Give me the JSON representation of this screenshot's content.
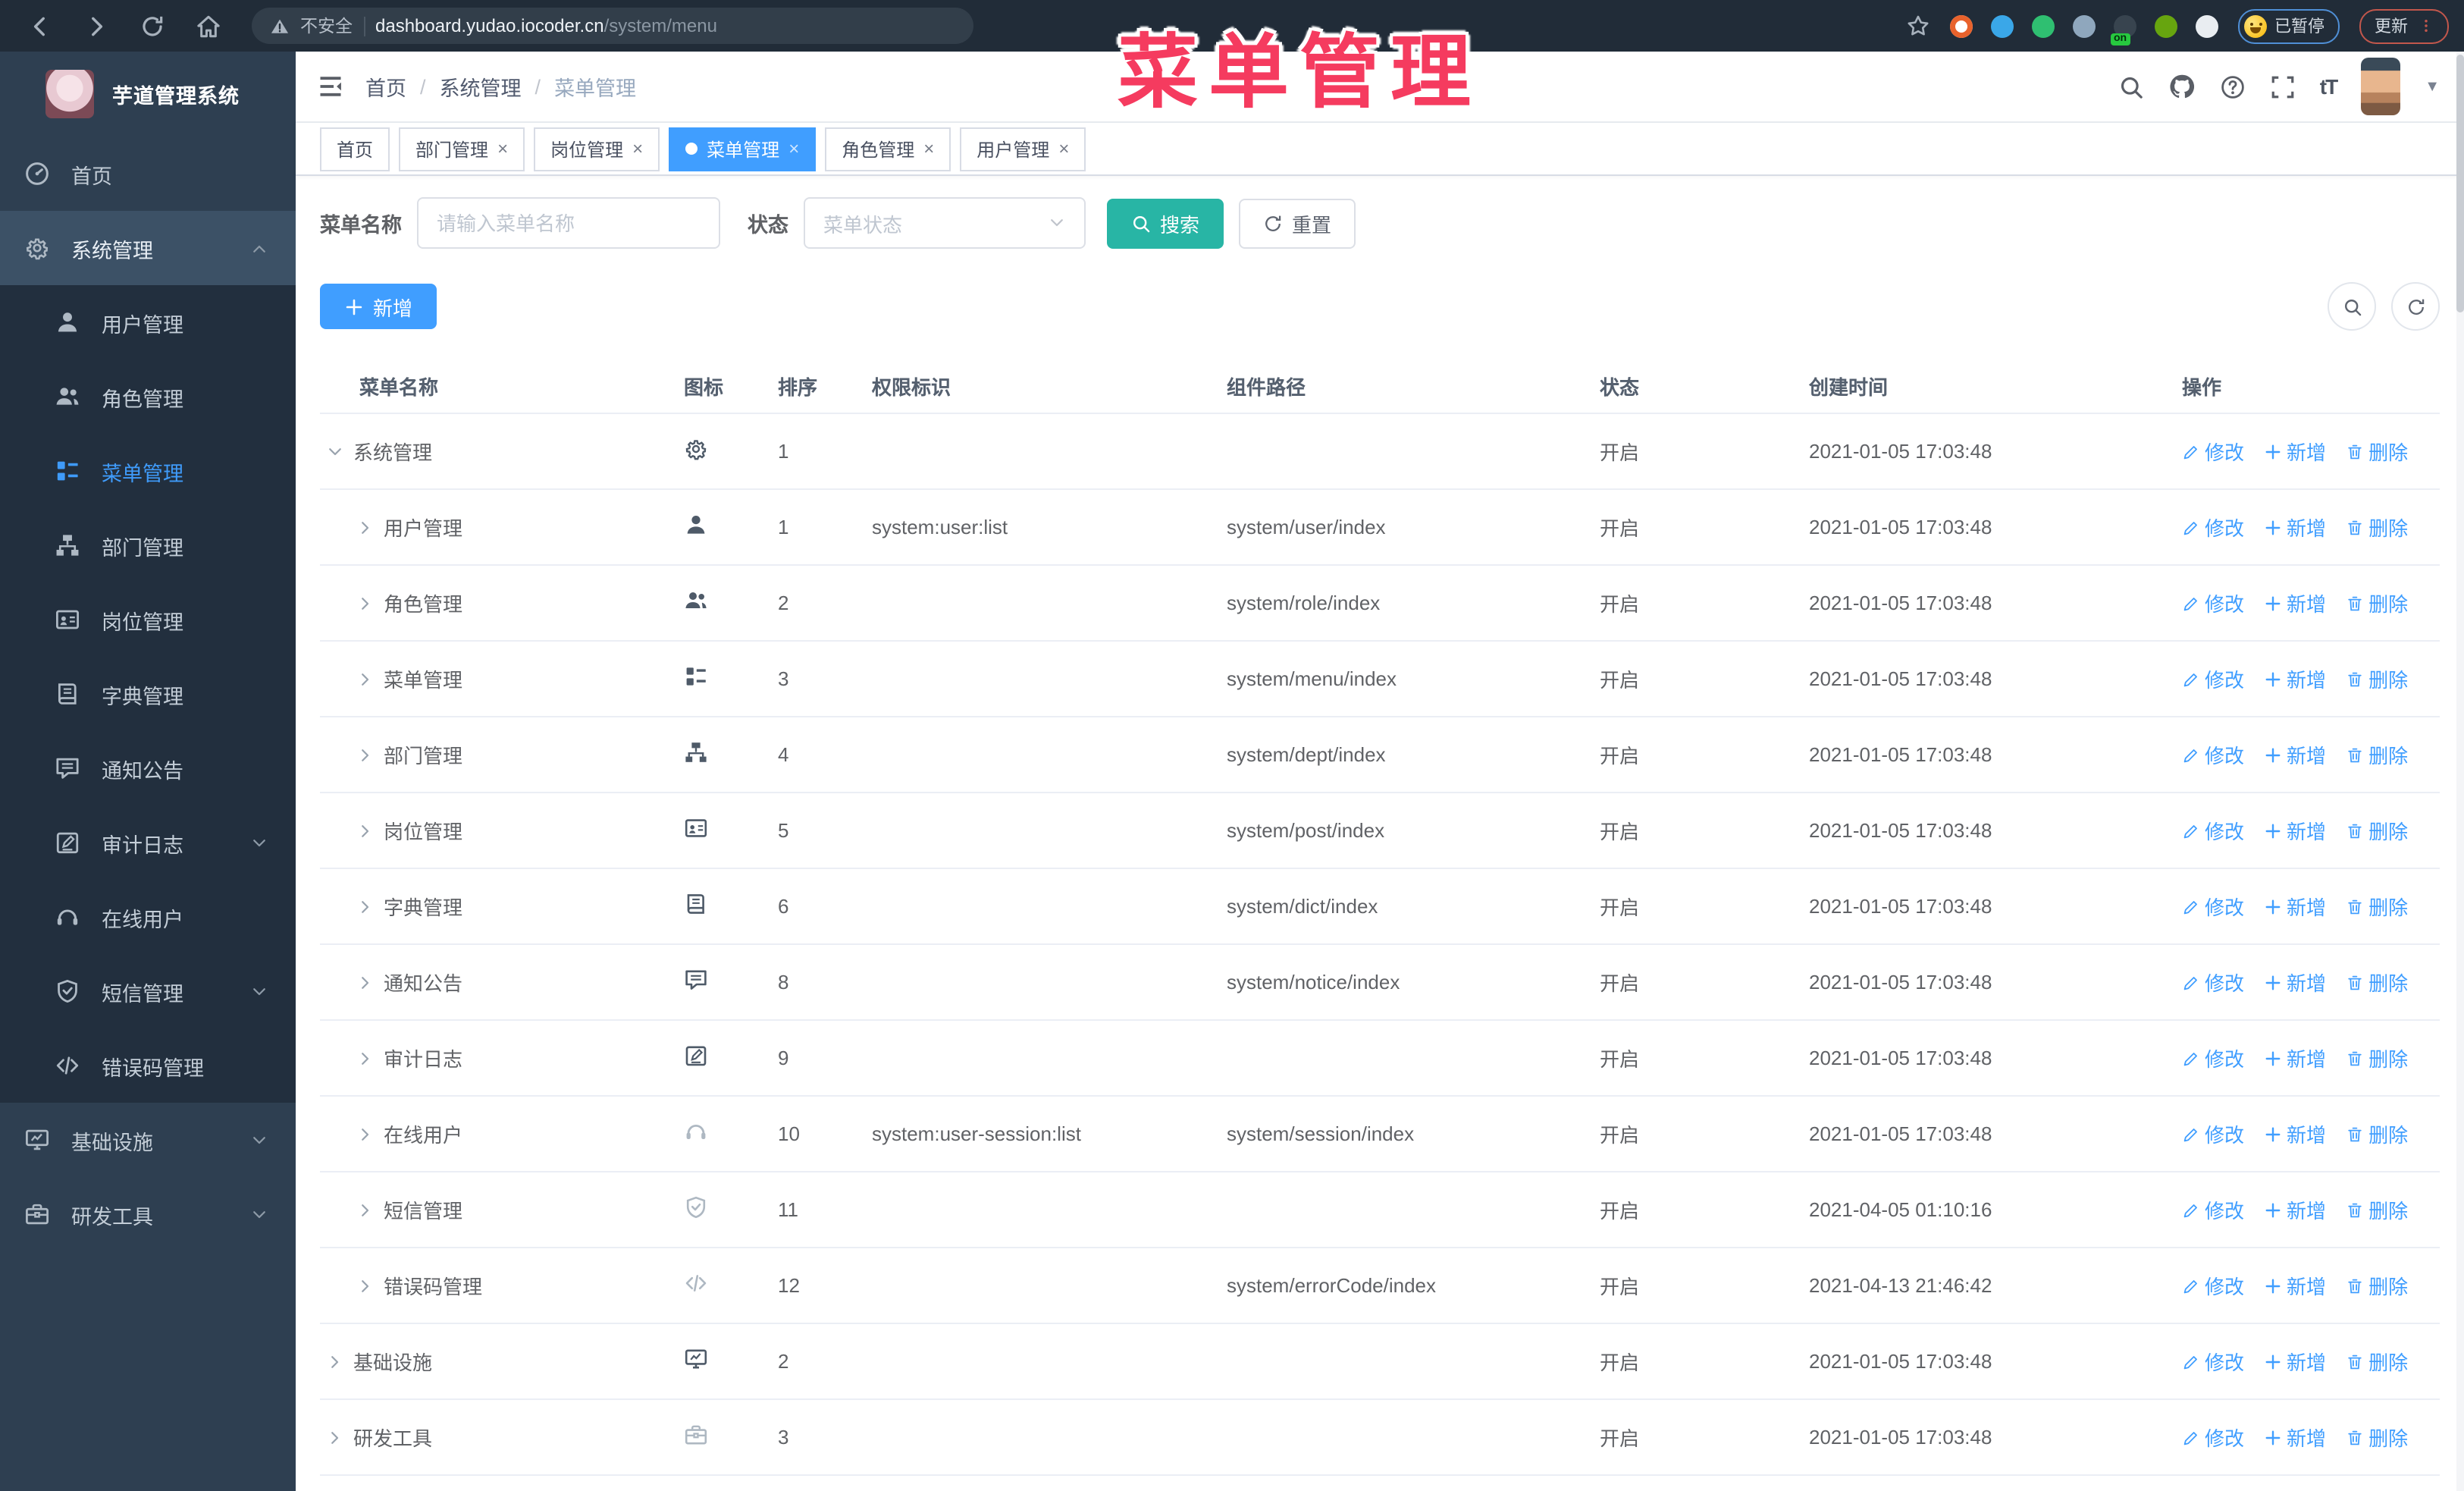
{
  "colors": {
    "accent": "#409eff",
    "teal": "#28b5a5",
    "overlay_red": "#f53b5f",
    "sidebar_bg": "#2e3f51",
    "submenu_bg": "#222f3e",
    "sidebar_open_bg": "#3c5166"
  },
  "overlay": {
    "title": "菜单管理"
  },
  "browser": {
    "nav_icons": [
      "back-icon",
      "forward-icon",
      "reload-icon",
      "home-icon"
    ],
    "security_label": "不安全",
    "url_host": "dashboard.yudao.iocoder.cn",
    "url_path": "/system/menu",
    "extensions": [
      {
        "name": "ext-orange-ring",
        "color": "#e8622c"
      },
      {
        "name": "ext-blue-gem",
        "color": "#3aa7e8"
      },
      {
        "name": "ext-green-check",
        "color": "#2fbf71"
      },
      {
        "name": "ext-blue-tabs",
        "color": "#8fa7bd"
      },
      {
        "name": "ext-dark-on",
        "color": "#38444f",
        "badge": "on"
      },
      {
        "name": "ext-green-frog",
        "color": "#67a50f"
      },
      {
        "name": "ext-puzzle",
        "color": "#e9edf1"
      }
    ],
    "paused_badge": "已暂停",
    "update_button": "更新"
  },
  "sidebar": {
    "logo_title": "芋道管理系统",
    "items": [
      {
        "label": "首页",
        "icon": "dashboard",
        "level": 0
      },
      {
        "label": "系统管理",
        "icon": "gear",
        "level": 0,
        "open": true,
        "chevron": "up"
      },
      {
        "label": "用户管理",
        "icon": "user",
        "level": 1
      },
      {
        "label": "角色管理",
        "icon": "users",
        "level": 1
      },
      {
        "label": "菜单管理",
        "icon": "menu",
        "level": 1,
        "active": true
      },
      {
        "label": "部门管理",
        "icon": "tree",
        "level": 1
      },
      {
        "label": "岗位管理",
        "icon": "badge",
        "level": 1
      },
      {
        "label": "字典管理",
        "icon": "book",
        "level": 1
      },
      {
        "label": "通知公告",
        "icon": "chat",
        "level": 1
      },
      {
        "label": "审计日志",
        "icon": "editlog",
        "level": 1,
        "chevron": "down"
      },
      {
        "label": "在线用户",
        "icon": "headset",
        "level": 1
      },
      {
        "label": "短信管理",
        "icon": "shield",
        "level": 1,
        "chevron": "down"
      },
      {
        "label": "错误码管理",
        "icon": "code",
        "level": 1
      },
      {
        "label": "基础设施",
        "icon": "monitor",
        "level": 0,
        "chevron": "down"
      },
      {
        "label": "研发工具",
        "icon": "toolbox",
        "level": 0,
        "chevron": "down"
      }
    ]
  },
  "header": {
    "breadcrumb": [
      "首页",
      "系统管理",
      "菜单管理"
    ],
    "right_icons": [
      "search-icon",
      "github-icon",
      "help-icon",
      "fullscreen-icon",
      "font-size-icon"
    ],
    "font_size_glyph": "tT"
  },
  "tabs": [
    {
      "label": "首页",
      "closable": false,
      "active": false
    },
    {
      "label": "部门管理",
      "closable": true,
      "active": false
    },
    {
      "label": "岗位管理",
      "closable": true,
      "active": false
    },
    {
      "label": "菜单管理",
      "closable": true,
      "active": true
    },
    {
      "label": "角色管理",
      "closable": true,
      "active": false
    },
    {
      "label": "用户管理",
      "closable": true,
      "active": false
    }
  ],
  "search": {
    "name_label": "菜单名称",
    "name_placeholder": "请输入菜单名称",
    "status_label": "状态",
    "status_placeholder": "菜单状态",
    "search_button": "搜索",
    "reset_button": "重置"
  },
  "toolbar": {
    "add_button": "新增"
  },
  "table": {
    "columns": [
      "菜单名称",
      "图标",
      "排序",
      "权限标识",
      "组件路径",
      "状态",
      "创建时间",
      "操作"
    ],
    "row_actions": [
      {
        "label": "修改",
        "icon": "pencil"
      },
      {
        "label": "新增",
        "icon": "plus"
      },
      {
        "label": "删除",
        "icon": "trash"
      }
    ],
    "rows": [
      {
        "name": "系统管理",
        "level": 0,
        "caret": "down",
        "icon": "gear",
        "sort": "1",
        "perms": "",
        "path": "",
        "status": "开启",
        "created": "2021-01-05 17:03:48"
      },
      {
        "name": "用户管理",
        "level": 1,
        "caret": "right",
        "icon": "user",
        "sort": "1",
        "perms": "system:user:list",
        "path": "system/user/index",
        "status": "开启",
        "created": "2021-01-05 17:03:48"
      },
      {
        "name": "角色管理",
        "level": 1,
        "caret": "right",
        "icon": "users",
        "sort": "2",
        "perms": "",
        "path": "system/role/index",
        "status": "开启",
        "created": "2021-01-05 17:03:48"
      },
      {
        "name": "菜单管理",
        "level": 1,
        "caret": "right",
        "icon": "menu",
        "sort": "3",
        "perms": "",
        "path": "system/menu/index",
        "status": "开启",
        "created": "2021-01-05 17:03:48"
      },
      {
        "name": "部门管理",
        "level": 1,
        "caret": "right",
        "icon": "tree",
        "sort": "4",
        "perms": "",
        "path": "system/dept/index",
        "status": "开启",
        "created": "2021-01-05 17:03:48"
      },
      {
        "name": "岗位管理",
        "level": 1,
        "caret": "right",
        "icon": "badge",
        "sort": "5",
        "perms": "",
        "path": "system/post/index",
        "status": "开启",
        "created": "2021-01-05 17:03:48"
      },
      {
        "name": "字典管理",
        "level": 1,
        "caret": "right",
        "icon": "book",
        "sort": "6",
        "perms": "",
        "path": "system/dict/index",
        "status": "开启",
        "created": "2021-01-05 17:03:48"
      },
      {
        "name": "通知公告",
        "level": 1,
        "caret": "right",
        "icon": "chat",
        "sort": "8",
        "perms": "",
        "path": "system/notice/index",
        "status": "开启",
        "created": "2021-01-05 17:03:48"
      },
      {
        "name": "审计日志",
        "level": 1,
        "caret": "right",
        "icon": "editlog",
        "sort": "9",
        "perms": "",
        "path": "",
        "status": "开启",
        "created": "2021-01-05 17:03:48"
      },
      {
        "name": "在线用户",
        "level": 1,
        "caret": "right",
        "icon": "headset",
        "icon_light": true,
        "sort": "10",
        "perms": "system:user-session:list",
        "path": "system/session/index",
        "status": "开启",
        "created": "2021-01-05 17:03:48"
      },
      {
        "name": "短信管理",
        "level": 1,
        "caret": "right",
        "icon": "shield",
        "icon_light": true,
        "sort": "11",
        "perms": "",
        "path": "",
        "status": "开启",
        "created": "2021-04-05 01:10:16"
      },
      {
        "name": "错误码管理",
        "level": 1,
        "caret": "right",
        "icon": "code",
        "icon_light": true,
        "sort": "12",
        "perms": "",
        "path": "system/errorCode/index",
        "status": "开启",
        "created": "2021-04-13 21:46:42"
      },
      {
        "name": "基础设施",
        "level": 0,
        "caret": "right",
        "icon": "monitor",
        "sort": "2",
        "perms": "",
        "path": "",
        "status": "开启",
        "created": "2021-01-05 17:03:48"
      },
      {
        "name": "研发工具",
        "level": 0,
        "caret": "right",
        "icon": "toolbox",
        "icon_light": true,
        "sort": "3",
        "perms": "",
        "path": "",
        "status": "开启",
        "created": "2021-01-05 17:03:48"
      }
    ]
  }
}
